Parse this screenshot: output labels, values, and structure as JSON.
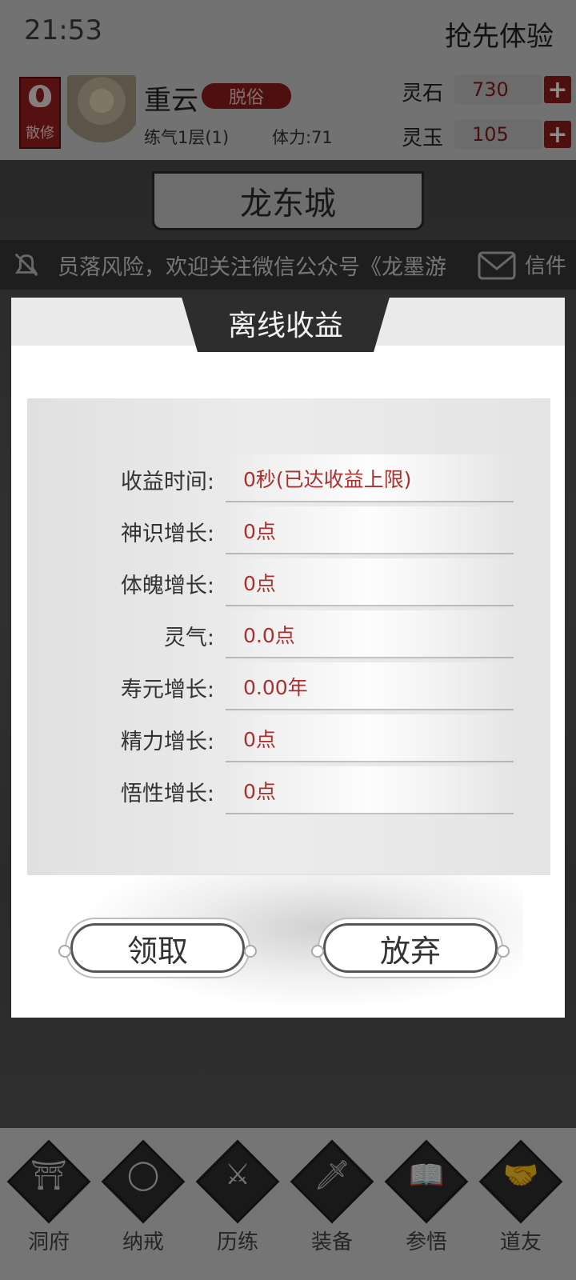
{
  "status_bar": {
    "time": "21:53",
    "right_label": "抢先体验"
  },
  "player": {
    "sect_label": "散修",
    "name": "重云",
    "rank_badge": "脱俗",
    "realm": "练气1层(1)",
    "stamina": "体力:71"
  },
  "resources": [
    {
      "label": "灵石",
      "value": "730"
    },
    {
      "label": "灵玉",
      "value": "105"
    }
  ],
  "location": {
    "city": "龙东城"
  },
  "marquee": {
    "text": "员落风险，欢迎关注微信公众号《龙墨游",
    "mail_label": "信件"
  },
  "modal": {
    "title": "离线收益",
    "rows": [
      {
        "label": "收益时间:",
        "value": "0秒(已达收益上限)"
      },
      {
        "label": "神识增长:",
        "value": "0点"
      },
      {
        "label": "体魄增长:",
        "value": "0点"
      },
      {
        "label": "灵气:",
        "value": "0.0点"
      },
      {
        "label": "寿元增长:",
        "value": "0.00年"
      },
      {
        "label": "精力增长:",
        "value": "0点"
      },
      {
        "label": "悟性增长:",
        "value": "0点"
      }
    ],
    "claim_label": "领取",
    "abandon_label": "放弃"
  },
  "nav": [
    {
      "label": "洞府",
      "icon": "gate-icon",
      "glyph": "⛩"
    },
    {
      "label": "纳戒",
      "icon": "ring-icon",
      "glyph": "◯"
    },
    {
      "label": "历练",
      "icon": "crossed-swords-icon",
      "glyph": "⚔"
    },
    {
      "label": "装备",
      "icon": "dagger-icon",
      "glyph": "🗡"
    },
    {
      "label": "参悟",
      "icon": "book-icon",
      "glyph": "📖"
    },
    {
      "label": "道友",
      "icon": "handshake-icon",
      "glyph": "🤝"
    }
  ],
  "colors": {
    "accent_red": "#8f1c1c",
    "value_red": "#a8312f",
    "dark": "#2d2d2d"
  }
}
